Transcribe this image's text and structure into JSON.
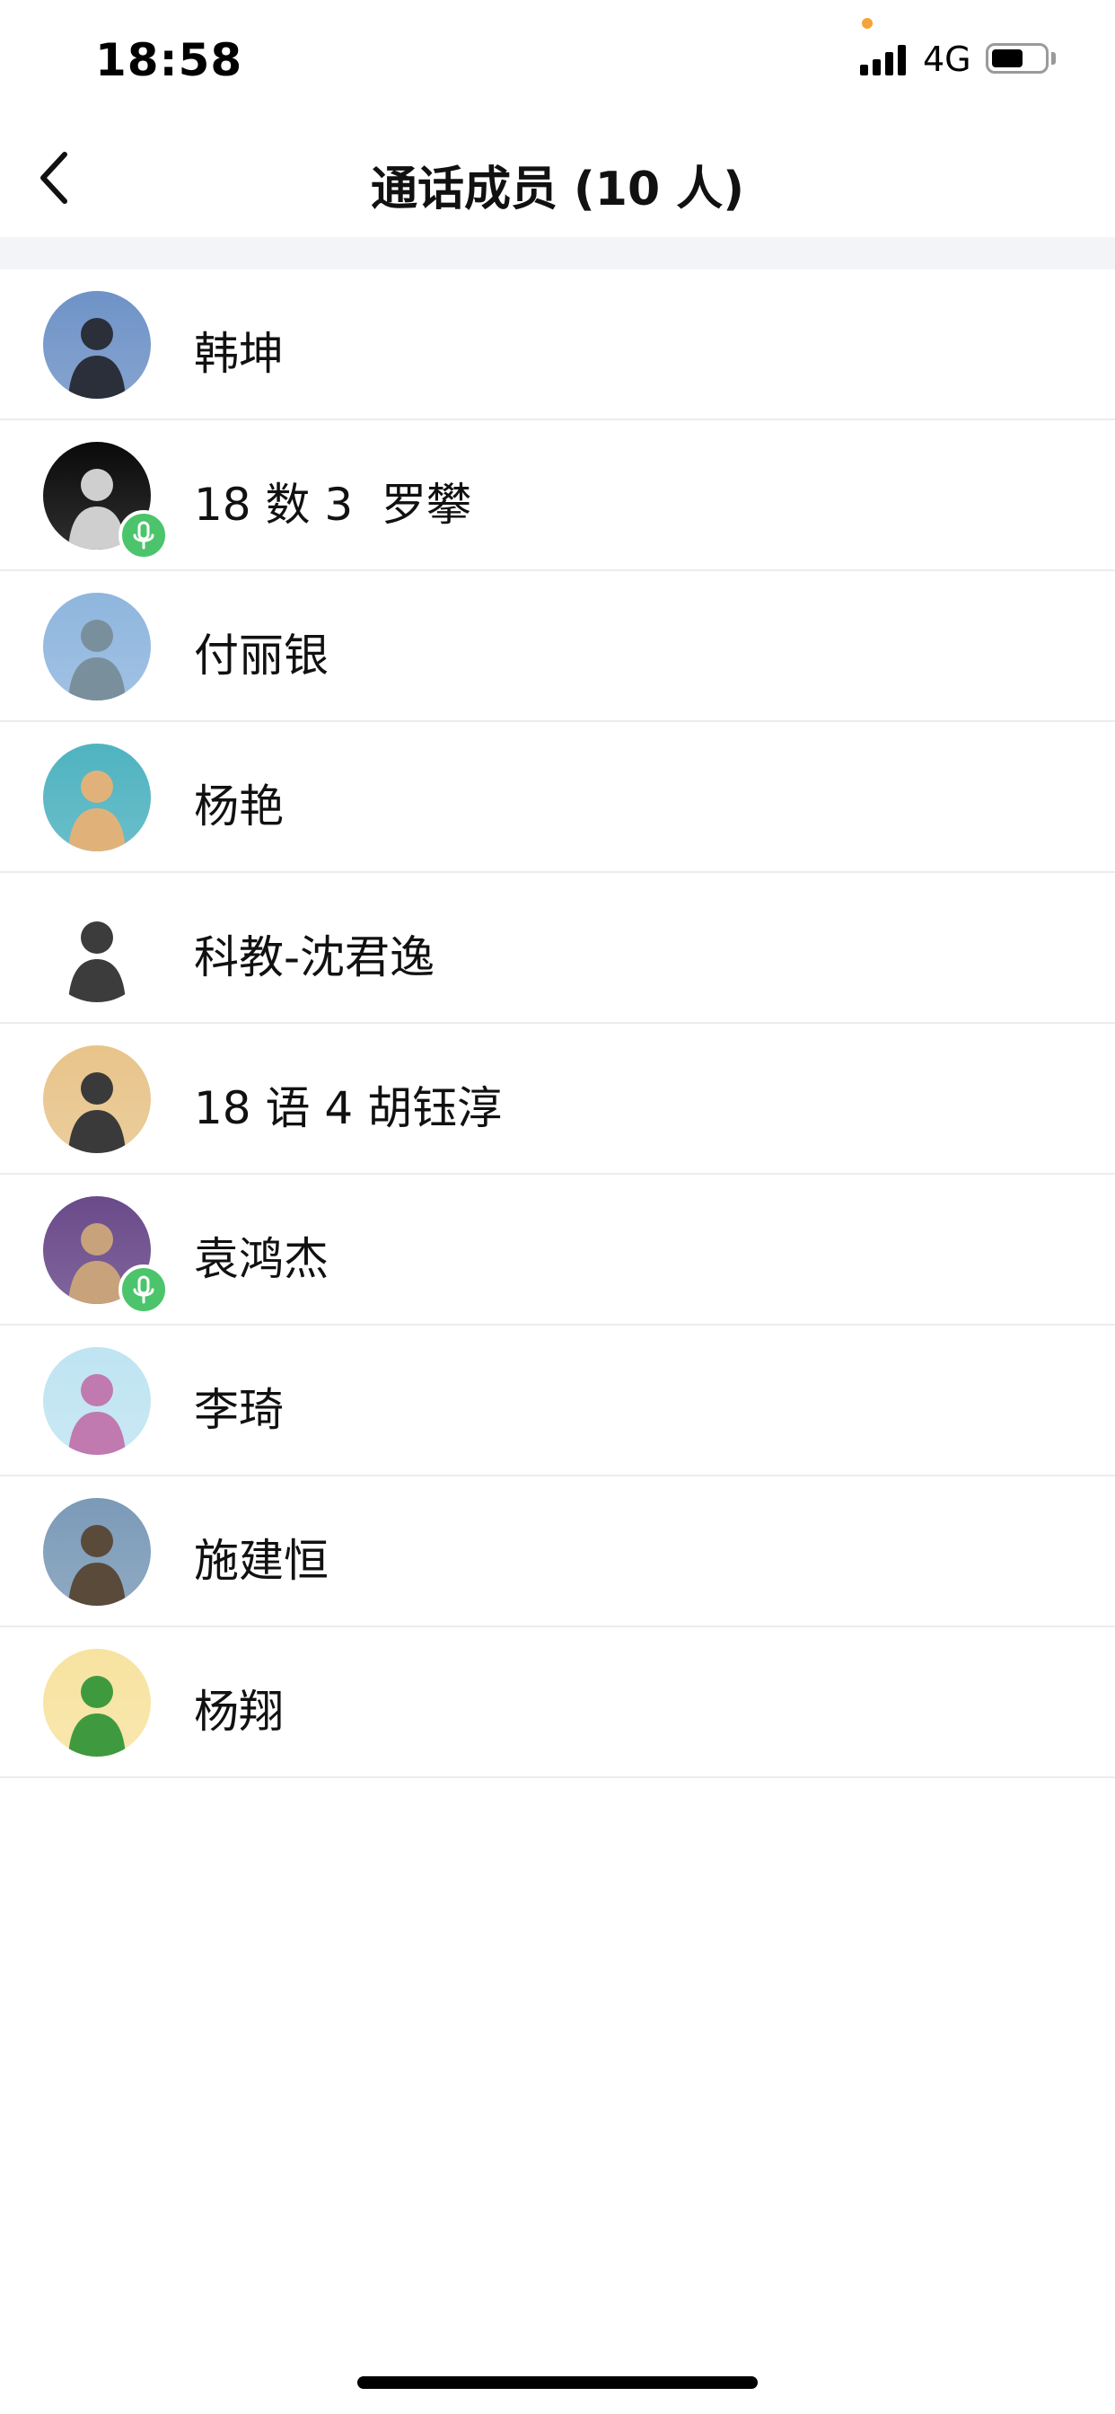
{
  "status_bar": {
    "time": "18:58",
    "network": "4G",
    "battery_level": 0.6,
    "signal_bars": 4
  },
  "nav": {
    "title": "通话成员 (10 人)",
    "back_icon": "chevron-left-icon"
  },
  "members": [
    {
      "name": "韩坤",
      "speaking": false,
      "avatar_colors": [
        "#6f93c7",
        "#2b2f3a"
      ]
    },
    {
      "name": "18 数 3  罗攀",
      "speaking": true,
      "avatar_colors": [
        "#0a0a0a",
        "#cfcfcf"
      ]
    },
    {
      "name": "付丽银",
      "speaking": false,
      "avatar_colors": [
        "#8fb6de",
        "#7a8f9c"
      ]
    },
    {
      "name": "杨艳",
      "speaking": false,
      "avatar_colors": [
        "#4fb3c0",
        "#e0b27a"
      ]
    },
    {
      "name": "科教-沈君逸",
      "speaking": false,
      "avatar_colors": [
        "#ffffff",
        "#3c3c3c"
      ]
    },
    {
      "name": "18 语 4 胡钰淳",
      "speaking": false,
      "avatar_colors": [
        "#e8c48a",
        "#3a3a3a"
      ]
    },
    {
      "name": "袁鸿杰",
      "speaking": true,
      "avatar_colors": [
        "#6a4a8a",
        "#c8a27a"
      ]
    },
    {
      "name": "李琦",
      "speaking": false,
      "avatar_colors": [
        "#bfe4f2",
        "#c07ab0"
      ]
    },
    {
      "name": "施建恒",
      "speaking": false,
      "avatar_colors": [
        "#7b9ab8",
        "#5a4a3a"
      ]
    },
    {
      "name": "杨翔",
      "speaking": false,
      "avatar_colors": [
        "#f7e3a0",
        "#3f9a3f"
      ]
    }
  ],
  "colors": {
    "accent_green": "#4cc46c",
    "status_dot": "#f5a43a",
    "band": "#f3f4f8",
    "divider": "#ececf0"
  },
  "icons": {
    "mic": "microphone-icon",
    "battery": "battery-icon",
    "signal": "signal-icon"
  }
}
